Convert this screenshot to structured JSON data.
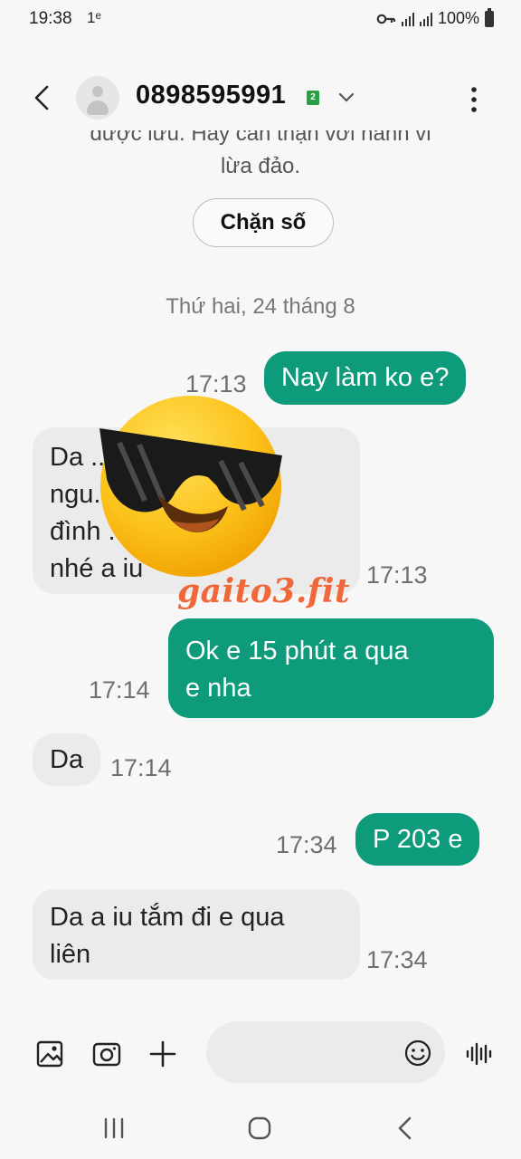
{
  "status_bar": {
    "time": "19:38",
    "notification_icon": "1ᵉ",
    "battery": "100%",
    "icons": [
      "key-icon",
      "wifi-calling-icon",
      "signal-icon",
      "battery-icon"
    ]
  },
  "header": {
    "phone": "0898595991",
    "sim_badge": "2",
    "icons": [
      "back-arrow-icon",
      "avatar-icon",
      "chevron-down-icon",
      "more-vert-icon"
    ]
  },
  "conversation": {
    "notice_line1": "được lưu. Hãy cẩn thận với hành vi",
    "notice_line2": "lừa đảo.",
    "block_button": "Chặn số",
    "date_separator": "Thứ hai, 24 tháng 8",
    "messages": [
      {
        "dir": "out",
        "lines": [
          "Nay làm ko e?"
        ],
        "time": "17:13"
      },
      {
        "dir": "in",
        "lines": [
          "Da ... minh",
          "ngu... han",
          "đình ... đà lạt",
          "nhé a iu"
        ],
        "time": "17:13"
      },
      {
        "dir": "out",
        "lines": [
          "Ok e  15 phút a qua",
          "e nha"
        ],
        "time": "17:14"
      },
      {
        "dir": "in",
        "lines": [
          "Da"
        ],
        "time": "17:14"
      },
      {
        "dir": "out",
        "lines": [
          "P 203 e"
        ],
        "time": "17:34"
      },
      {
        "dir": "in",
        "lines": [
          "Da a iu tắm đi e qua",
          "liên"
        ],
        "time": "17:34"
      }
    ]
  },
  "overlay": {
    "watermark": "gaito3.fit",
    "sticker": "sunglasses-emoji"
  },
  "composer": {
    "placeholder": "",
    "icons": [
      "gallery-icon",
      "camera-icon",
      "plus-icon",
      "emoji-icon",
      "voice-icon"
    ]
  },
  "navbar": {
    "icons": [
      "recents-icon",
      "home-icon",
      "back-nav-icon"
    ]
  },
  "colors": {
    "outgoing_bubble": "#0d9b7c",
    "incoming_bubble": "#ebebeb",
    "background": "#f7f7f7",
    "watermark": "#f0683a"
  }
}
